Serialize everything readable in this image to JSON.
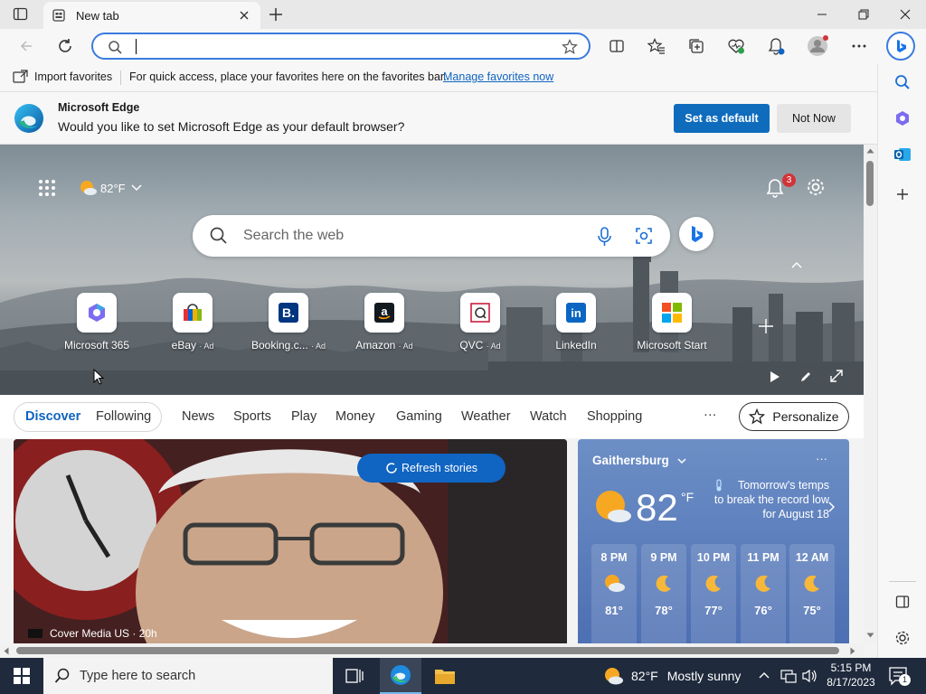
{
  "browser": {
    "tab_title": "New tab",
    "address_value": ""
  },
  "favorites_bar": {
    "import_label": "Import favorites",
    "hint": "For quick access, place your favorites here on the favorites bar.",
    "manage_link": "Manage favorites now"
  },
  "infobar": {
    "title": "Microsoft Edge",
    "message": "Would you like to set Microsoft Edge as your default browser?",
    "primary": "Set as default",
    "secondary": "Not Now"
  },
  "newtab": {
    "weather_temp": "82°F",
    "search_placeholder": "Search the web",
    "notif_count": "3",
    "tiles": [
      {
        "label": "Microsoft 365",
        "ad": ""
      },
      {
        "label": "eBay",
        "ad": "· Ad"
      },
      {
        "label": "Booking.c...",
        "ad": "· Ad"
      },
      {
        "label": "Amazon",
        "ad": "· Ad"
      },
      {
        "label": "QVC",
        "ad": "· Ad"
      },
      {
        "label": "LinkedIn",
        "ad": ""
      },
      {
        "label": "Microsoft Start",
        "ad": ""
      }
    ]
  },
  "feed": {
    "tabs": [
      "Discover",
      "Following",
      "News",
      "Sports",
      "Play",
      "Money",
      "Gaming",
      "Weather",
      "Watch",
      "Shopping"
    ],
    "more": "···",
    "personalize": "Personalize",
    "refresh": "Refresh stories",
    "story_source": "Cover Media US · 20h"
  },
  "weather_card": {
    "location": "Gaithersburg",
    "temp": "82",
    "unit": "°F",
    "alert_line1": "Tomorrow's temps",
    "alert_line2": "to break the record low",
    "alert_line3": "for August 18",
    "more": "···",
    "hours": [
      {
        "time": "8 PM",
        "temp": "81°",
        "icon": "partly-cloudy-icon"
      },
      {
        "time": "9 PM",
        "temp": "78°",
        "icon": "moon-icon"
      },
      {
        "time": "10 PM",
        "temp": "77°",
        "icon": "moon-icon"
      },
      {
        "time": "11 PM",
        "temp": "76°",
        "icon": "moon-icon"
      },
      {
        "time": "12 AM",
        "temp": "75°",
        "icon": "moon-icon"
      }
    ]
  },
  "taskbar": {
    "search_placeholder": "Type here to search",
    "weather": "82°F",
    "weather_desc": "Mostly sunny",
    "time": "5:15 PM",
    "date": "8/17/2023",
    "notif_count": "1"
  },
  "colors": {
    "accent": "#0f6cbd",
    "link": "#1064c2",
    "taskbar": "#1f2a3c"
  }
}
